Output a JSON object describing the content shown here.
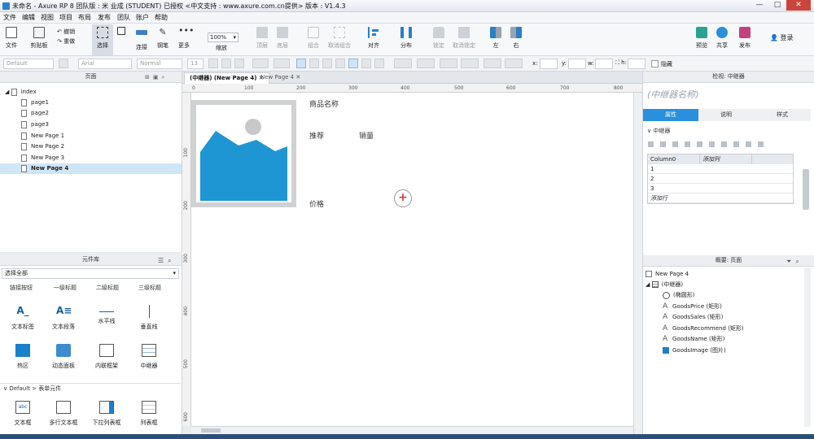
{
  "titlebar": {
    "title": "未命名 - Axure RP 8 团队版 : 米 业成 (STUDENT) 已授权       <中文支持 : www.axure.com.cn提供> 版本 : V1.4.3",
    "min": "—",
    "max": "□",
    "close": "✕"
  },
  "menu": [
    "文件",
    "编辑",
    "视图",
    "项目",
    "布局",
    "发布",
    "团队",
    "账户",
    "帮助"
  ],
  "toolbar": {
    "file": "文件",
    "clipboard": "剪贴板",
    "undo": "撤销",
    "redo": "重做",
    "select": "选择",
    "connect": "连接",
    "pen": "钢笔",
    "more": "更多",
    "zoom_value": "100%",
    "zoom_label": "缩放",
    "top": "顶层",
    "bottom": "底层",
    "group": "组合",
    "ungroup": "取消组合",
    "align": "对齐",
    "distribute": "分布",
    "lock": "锁定",
    "unlock": "取消锁定",
    "left": "左",
    "right": "右",
    "preview": "预览",
    "share": "共享",
    "publish": "发布",
    "login": "登录"
  },
  "format": {
    "style": "Default",
    "font": "Arial",
    "weight": "Normal",
    "size": "13",
    "x_label": "x:",
    "y_label": "y:",
    "w_label": "w:",
    "h_label": "h:",
    "hidden": "隐藏"
  },
  "pages": {
    "header": "页面",
    "root": "index",
    "items": [
      "page1",
      "page2",
      "page3",
      "New Page 1",
      "New Page 2",
      "New Page 3",
      "New Page 4"
    ],
    "selected": "New Page 4"
  },
  "library": {
    "header": "元件库",
    "filter": "选择全部",
    "top_row": [
      "链接按钮",
      "一级标题",
      "二级标题",
      "三级标题"
    ],
    "row1": [
      "文本标签",
      "文本段落",
      "水平线",
      "垂直线"
    ],
    "row2": [
      "热区",
      "动态面板",
      "内联框架",
      "中继器"
    ],
    "section": "Default > 表单元件",
    "row3": [
      "文本框",
      "多行文本框",
      "下拉列表框",
      "列表框"
    ],
    "row3_icon_text": "abc"
  },
  "tabs": {
    "active": "(中继器) (New Page 4)",
    "inactive": "New Page 4"
  },
  "ruler_h": [
    "0",
    "100",
    "200",
    "300",
    "400",
    "500",
    "600",
    "700",
    "800"
  ],
  "ruler_v": [
    "100",
    "200",
    "300",
    "400",
    "500",
    "600"
  ],
  "canvas": {
    "goods_name": "商品名称",
    "recommend": "推荐",
    "sales": "销量",
    "price": "价格",
    "add_symbol": "+"
  },
  "inspector": {
    "header": "检视: 中继器",
    "name_placeholder": "(中继器名称)",
    "tabs": [
      "属性",
      "说明",
      "样式"
    ],
    "section": "中继器",
    "grid_header": [
      "Column0",
      "添加列"
    ],
    "grid_rows": [
      "1",
      "2",
      "3"
    ],
    "add_row": "添加行"
  },
  "outline": {
    "header": "概要: 页面",
    "page": "New Page 4",
    "repeater": "(中继器)",
    "items": [
      {
        "label": "(椭圆形)",
        "icon": "ellipse-icon"
      },
      {
        "label": "GoodsPrice (矩形)",
        "icon": "text-icon"
      },
      {
        "label": "GoodsSales (矩形)",
        "icon": "text-icon"
      },
      {
        "label": "GoodsRecommend (矩形)",
        "icon": "text-icon"
      },
      {
        "label": "GoodsName (矩形)",
        "icon": "text-icon"
      },
      {
        "label": "GoodsImage (图片)",
        "icon": "image-icon"
      }
    ]
  },
  "colors": {
    "accent": "#2a8fdc",
    "image_fill": "#1e96d4",
    "add_red": "#d43c3c"
  }
}
